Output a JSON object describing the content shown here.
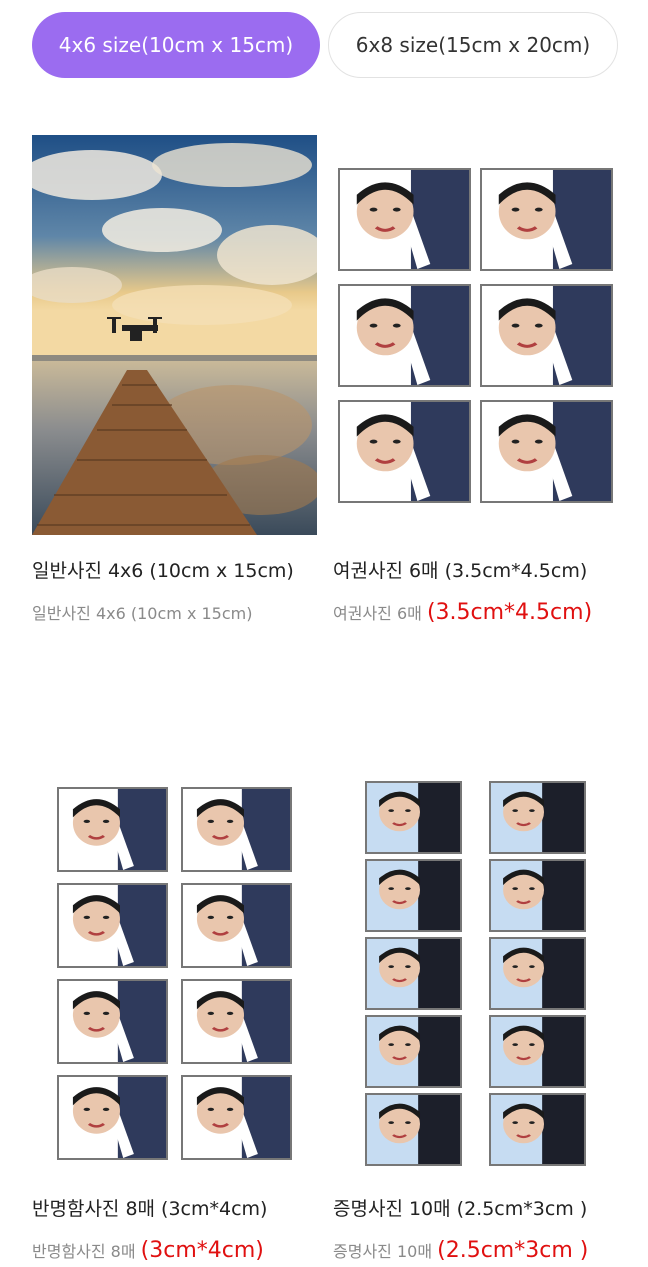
{
  "tabs": [
    {
      "label": "4x6 size(10cm x 15cm)",
      "active": true
    },
    {
      "label": "6x8 size(15cm x 20cm)",
      "active": false
    }
  ],
  "products": [
    {
      "title": "일반사진 4x6 (10cm x 15cm)",
      "sub_prefix": "일반사진 4x6 (10cm x 15cm)",
      "sub_accent": ""
    },
    {
      "title": "여권사진 6매 (3.5cm*4.5cm)",
      "sub_prefix": "여권사진 6매 ",
      "sub_accent": "(3.5cm*4.5cm)"
    },
    {
      "title": "반명함사진 8매 (3cm*4cm)",
      "sub_prefix": "반명함사진 8매 ",
      "sub_accent": "(3cm*4cm)"
    },
    {
      "title": "증명사진 10매 (2.5cm*3cm )",
      "sub_prefix": "증명사진 10매 ",
      "sub_accent": "(2.5cm*3cm )"
    }
  ],
  "colors": {
    "accent": "#9b6cf0",
    "price_red": "#e01010"
  },
  "icons": {
    "landscape": "dock-lake-drone-photo",
    "portrait": "id-portrait-photo"
  }
}
